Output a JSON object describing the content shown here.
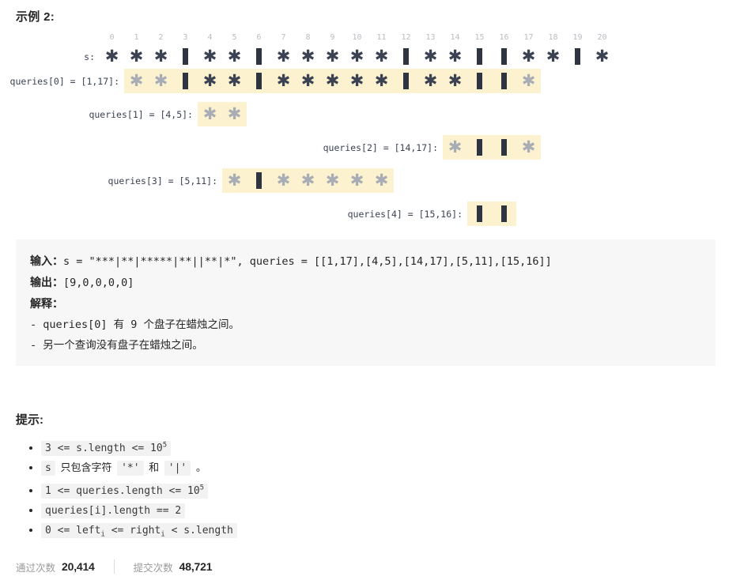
{
  "example": {
    "title": "示例 2:"
  },
  "diagram": {
    "s_label": "s:",
    "indices": [
      "0",
      "1",
      "2",
      "3",
      "4",
      "5",
      "6",
      "7",
      "8",
      "9",
      "10",
      "11",
      "12",
      "13",
      "14",
      "15",
      "16",
      "17",
      "18",
      "19",
      "20"
    ],
    "string": "***|**|*****|**||**|*",
    "chars": [
      "*",
      "*",
      "*",
      "|",
      "*",
      "*",
      "|",
      "*",
      "*",
      "*",
      "*",
      "*",
      "|",
      "*",
      "*",
      "|",
      "|",
      "*",
      "*",
      "|",
      "*"
    ],
    "rows": [
      {
        "label": "queries[0] = [1,17]:",
        "start": 1,
        "end": 17,
        "dim": [
          1,
          2,
          17
        ]
      },
      {
        "label": "queries[1] = [4,5]:",
        "start": 4,
        "end": 5,
        "dim": [
          4,
          5
        ]
      },
      {
        "label": "queries[2] = [14,17]:",
        "start": 14,
        "end": 17,
        "dim": [
          14,
          17
        ]
      },
      {
        "label": "queries[3] = [5,11]:",
        "start": 5,
        "end": 11,
        "dim": [
          5,
          7,
          8,
          9,
          10,
          11
        ]
      },
      {
        "label": "queries[4] = [15,16]:",
        "start": 15,
        "end": 16,
        "dim": []
      }
    ]
  },
  "description": {
    "input_label": "输入：",
    "input_value": "s = \"***|**|*****|**||**|*\", queries = [[1,17],[4,5],[14,17],[5,11],[15,16]]",
    "output_label": "输出：",
    "output_value": "[9,0,0,0,0]",
    "explain_label": "解释：",
    "explain_lines": [
      "- queries[0] 有 9 个盘子在蜡烛之间。",
      "- 另一个查询没有盘子在蜡烛之间。"
    ]
  },
  "hints": {
    "title": "提示:",
    "items": [
      {
        "type": "code_sup",
        "pre": "3 <= s.length <= 10",
        "sup": "5"
      },
      {
        "type": "mixed",
        "parts": [
          "s",
          " 只包含字符 ",
          "'*'",
          " 和 ",
          "'|'",
          " 。"
        ]
      },
      {
        "type": "code_sup",
        "pre": "1 <= queries.length <= 10",
        "sup": "5"
      },
      {
        "type": "code",
        "text": "queries[i].length == 2"
      },
      {
        "type": "code_sub",
        "a": "0 <= left",
        "sub1": "i",
        "b": " <= right",
        "sub2": "i",
        "c": " < s.length"
      }
    ]
  },
  "stats": {
    "accepted_label": "通过次数",
    "accepted_value": "20,414",
    "submissions_label": "提交次数",
    "submissions_value": "48,721"
  },
  "colors": {
    "highlight": "#fdf2d0",
    "glyph_dark": "#3b4252",
    "glyph_dim": "#a8adb5",
    "code_bg": "#f7f7f7"
  }
}
